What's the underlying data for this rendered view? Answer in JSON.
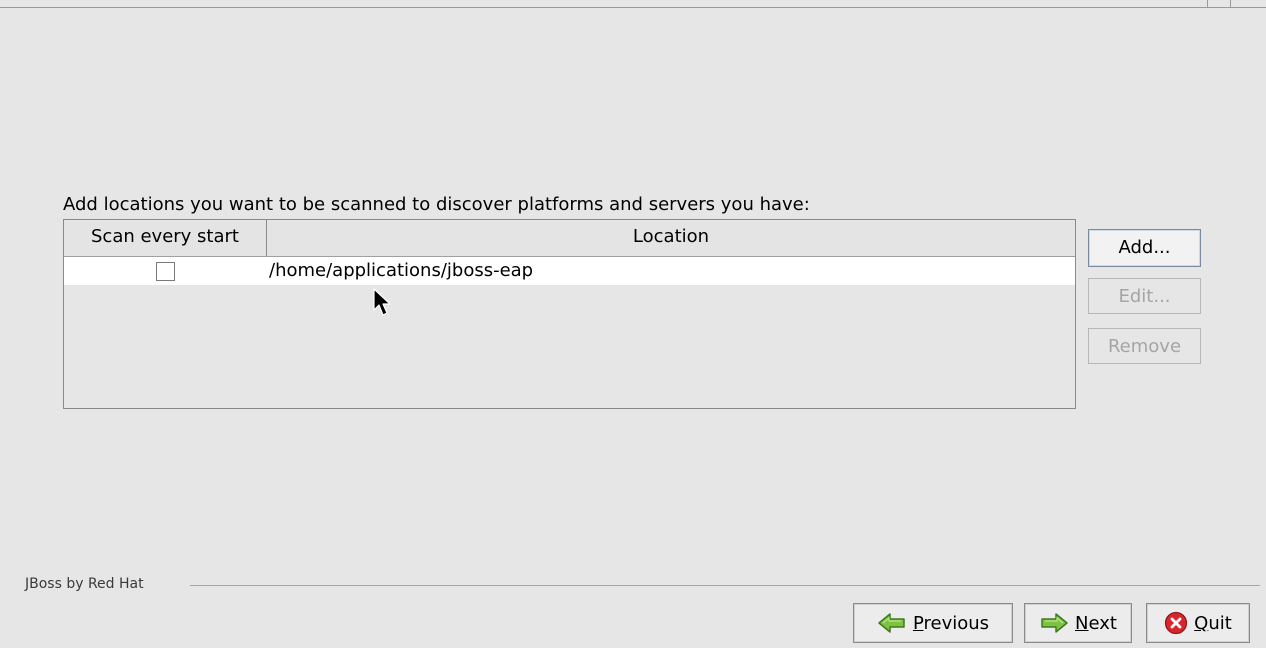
{
  "instruction": "Add locations you want to be scanned to discover platforms and servers you have:",
  "table": {
    "columns": [
      "Scan every start",
      "Location"
    ],
    "rows": [
      {
        "scan_every_start": false,
        "location": "/home/applications/jboss-eap"
      }
    ]
  },
  "side_buttons": {
    "add": "Add...",
    "edit": "Edit...",
    "remove": "Remove"
  },
  "footer": {
    "brand": "JBoss by Red Hat",
    "previous_mnemonic": "P",
    "previous_rest": "revious",
    "next_mnemonic": "N",
    "next_rest": "ext",
    "quit_mnemonic": "Q",
    "quit_rest": "uit"
  },
  "icons": {
    "previous": "green-arrow-left-icon",
    "next": "green-arrow-right-icon",
    "quit": "red-x-circle-icon"
  }
}
